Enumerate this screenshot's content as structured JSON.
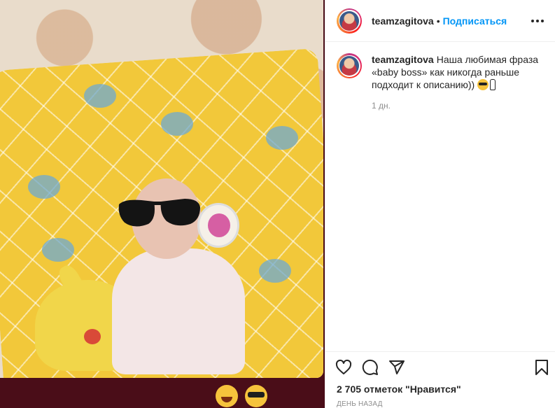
{
  "post": {
    "username": "teamzagitova",
    "separator": "•",
    "follow_label": "Подписаться",
    "more_icon": "more-horizontal-icon"
  },
  "caption": {
    "username": "teamzagitova",
    "text": "Наша любимая фраза «baby boss» как никогда раньше подходит к описанию))",
    "emojis": [
      "smiling-face-with-sunglasses",
      "baby-bottle"
    ],
    "time": "1 дн."
  },
  "actions": {
    "icons": [
      "heart-icon",
      "comment-icon",
      "share-icon",
      "bookmark-icon"
    ]
  },
  "likes": {
    "text": "2 705 отметок \"Нравится\""
  },
  "timestamp": {
    "text": "ДЕНЬ НАЗАД"
  },
  "photo": {
    "reactions": [
      "laughing-face",
      "sunglasses-face"
    ]
  },
  "colors": {
    "accent": "#0095f6",
    "text": "#262626",
    "muted": "#8e8e8e",
    "border": "#efefef"
  }
}
